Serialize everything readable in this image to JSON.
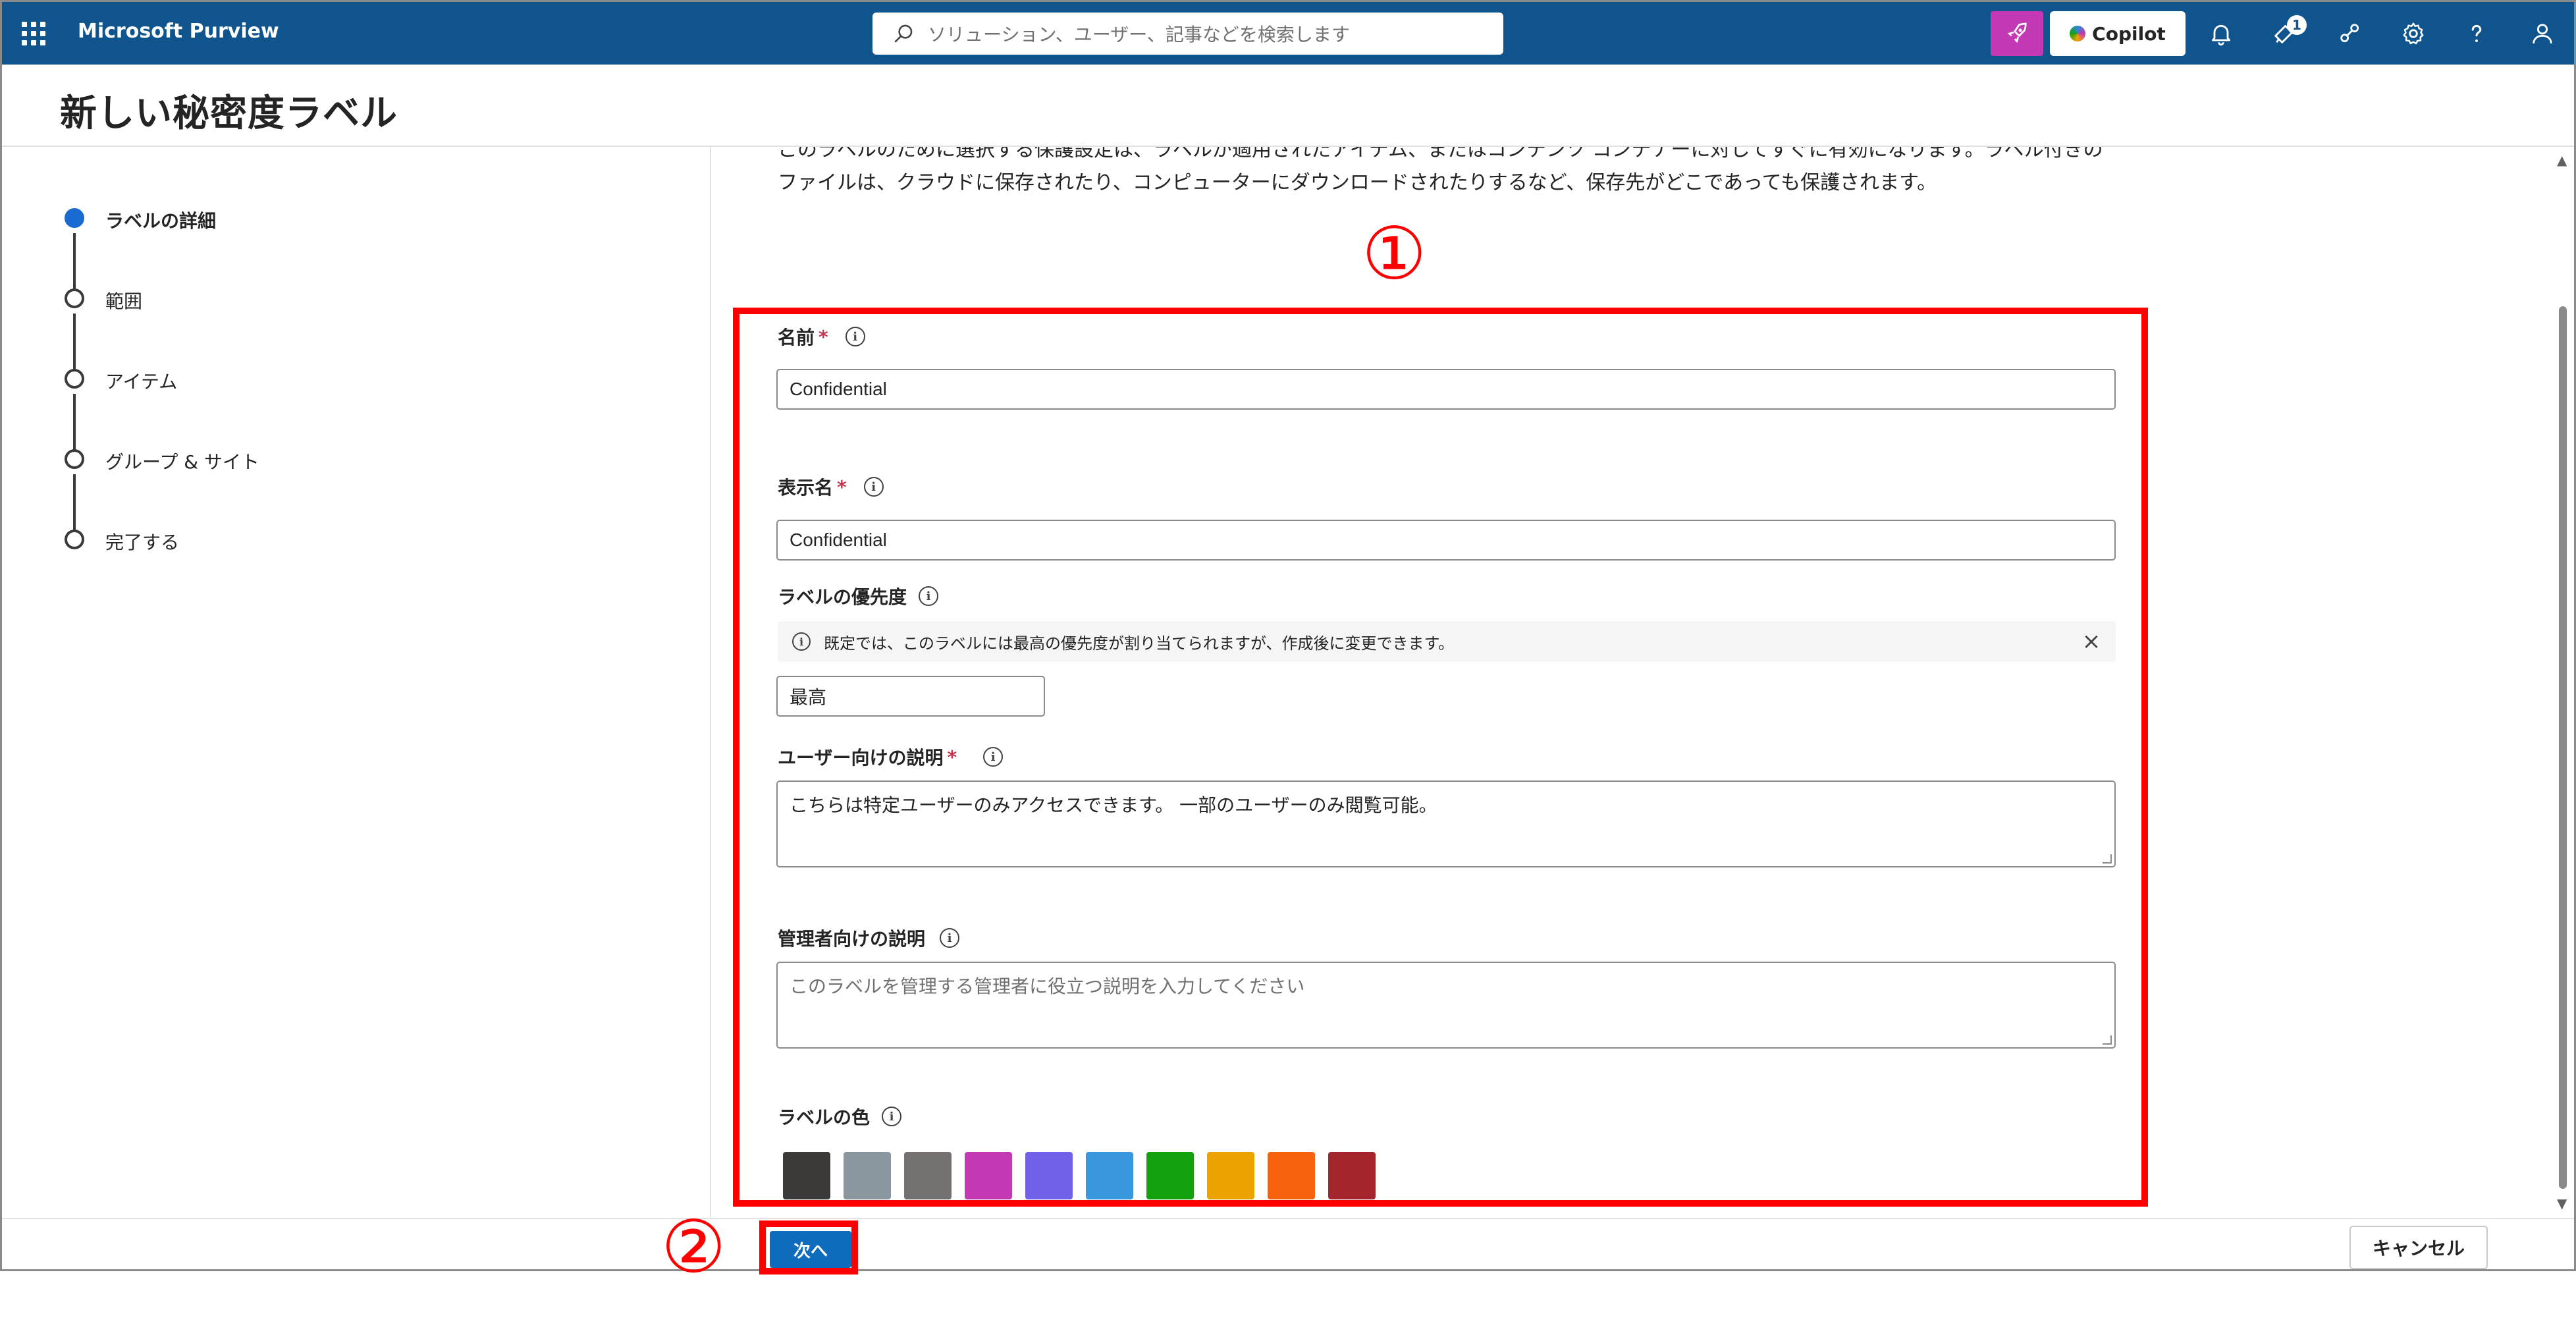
{
  "app": {
    "name": "Microsoft Purview"
  },
  "topbar": {
    "search_placeholder": "ソリューション、ユーザー、記事などを検索します",
    "copilot_label": "Copilot",
    "notification_badge": "1",
    "accent_color": "#0f548c"
  },
  "page": {
    "title": "新しい秘密度ラベル"
  },
  "steps": [
    {
      "label": "ラベルの詳細",
      "state": "current"
    },
    {
      "label": "範囲",
      "state": "pending"
    },
    {
      "label": "アイテム",
      "state": "pending"
    },
    {
      "label": "グループ & サイト",
      "state": "pending"
    },
    {
      "label": "完了する",
      "state": "pending"
    }
  ],
  "intro": {
    "text": "このラベルのために選択する保護設定は、ラベルが適用されたアイテム、またはコンテンツ コンテナーに対してすぐに有効になります。ラベル付きのファイルは、クラウドに保存されたり、コンピューターにダウンロードされたりするなど、保存先がどこであっても保護されます。"
  },
  "form": {
    "name": {
      "label": "名前",
      "required": "*",
      "value": "Confidential"
    },
    "display_name": {
      "label": "表示名",
      "required": "*",
      "value": "Confidential"
    },
    "priority": {
      "label": "ラベルの優先度",
      "message": "既定では、このラベルには最高の優先度が割り当てられますが、作成後に変更できます。",
      "value": "最高"
    },
    "user_description": {
      "label": "ユーザー向けの説明",
      "required": "*",
      "value": "こちらは特定ユーザーのみアクセスできます。 一部のユーザーのみ閲覧可能。"
    },
    "admin_description": {
      "label": "管理者向けの説明",
      "placeholder": "このラベルを管理する管理者に役立つ説明を入力してください"
    },
    "color": {
      "label": "ラベルの色",
      "swatches": [
        "#3b3a39",
        "#8a979e",
        "#767171",
        "#c239b3",
        "#7160e8",
        "#3a96dd",
        "#13a10e",
        "#eaa300",
        "#f7630c",
        "#a4262c"
      ]
    }
  },
  "footer": {
    "next_label": "次へ",
    "cancel_label": "キャンセル"
  },
  "annotations": {
    "marker_1": "①",
    "marker_2": "②",
    "color": "#ff0000"
  }
}
